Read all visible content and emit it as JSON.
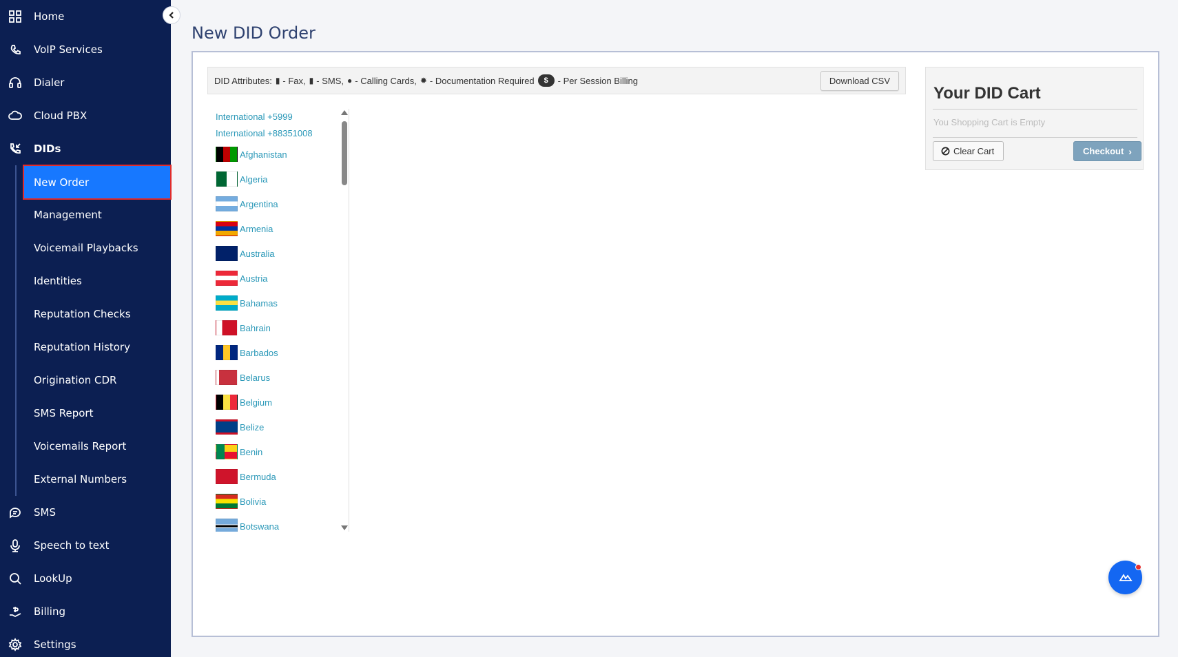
{
  "sidebar": {
    "items": [
      {
        "label": "Home",
        "icon": "grid-icon"
      },
      {
        "label": "VoIP Services",
        "icon": "voip-icon"
      },
      {
        "label": "Dialer",
        "icon": "headset-icon"
      },
      {
        "label": "Cloud PBX",
        "icon": "cloud-icon"
      },
      {
        "label": "DIDs",
        "icon": "phone-incoming-icon"
      }
    ],
    "dids_sub": [
      {
        "label": "New Order"
      },
      {
        "label": "Management"
      },
      {
        "label": "Voicemail Playbacks"
      },
      {
        "label": "Identities"
      },
      {
        "label": "Reputation Checks"
      },
      {
        "label": "Reputation History"
      },
      {
        "label": "Origination CDR"
      },
      {
        "label": "SMS Report"
      },
      {
        "label": "Voicemails Report"
      },
      {
        "label": "External Numbers"
      }
    ],
    "bottom_items": [
      {
        "label": "SMS",
        "icon": "sms-icon"
      },
      {
        "label": "Speech to text",
        "icon": "mic-icon"
      },
      {
        "label": "LookUp",
        "icon": "search-icon"
      },
      {
        "label": "Billing",
        "icon": "billing-icon"
      },
      {
        "label": "Settings",
        "icon": "gear-icon"
      }
    ]
  },
  "page": {
    "title": "New DID Order"
  },
  "attributes": {
    "prefix": "DID Attributes:",
    "fax": "- Fax,",
    "sms": "- SMS,",
    "calling_cards": "- Calling Cards,",
    "docs": "- Documentation Required",
    "dollar": "$",
    "per_session": "- Per Session Billing",
    "download_label": "Download CSV"
  },
  "countries": {
    "international": [
      "International +5999",
      "International +88351008"
    ],
    "list": [
      {
        "name": "Afghanistan",
        "flag": "afghanistan"
      },
      {
        "name": "Algeria",
        "flag": "algeria"
      },
      {
        "name": "Argentina",
        "flag": "argentina"
      },
      {
        "name": "Armenia",
        "flag": "armenia"
      },
      {
        "name": "Australia",
        "flag": "australia"
      },
      {
        "name": "Austria",
        "flag": "austria"
      },
      {
        "name": "Bahamas",
        "flag": "bahamas"
      },
      {
        "name": "Bahrain",
        "flag": "bahrain"
      },
      {
        "name": "Barbados",
        "flag": "barbados"
      },
      {
        "name": "Belarus",
        "flag": "belarus"
      },
      {
        "name": "Belgium",
        "flag": "belgium"
      },
      {
        "name": "Belize",
        "flag": "belize"
      },
      {
        "name": "Benin",
        "flag": "benin"
      },
      {
        "name": "Bermuda",
        "flag": "bermuda"
      },
      {
        "name": "Bolivia",
        "flag": "bolivia"
      },
      {
        "name": "Botswana",
        "flag": "botswana"
      }
    ]
  },
  "cart": {
    "title": "Your DID Cart",
    "empty_text": "You Shopping Cart is Empty",
    "clear_label": "Clear Cart",
    "checkout_label": "Checkout"
  },
  "colors": {
    "sidebar_bg": "#0c1f52",
    "active_bg": "#1778ff",
    "link": "#2a98b8",
    "checkout": "#7ea3bd"
  }
}
